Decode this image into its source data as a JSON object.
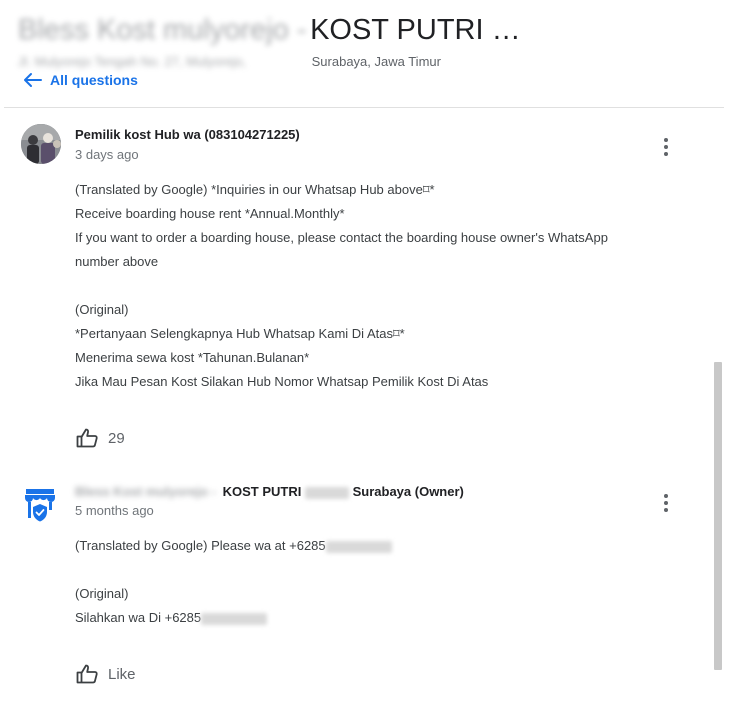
{
  "header": {
    "title_blurred": "Bless Kost mulyorejo -",
    "title": "KOST PUTRI …",
    "subtitle_blurred": "Jl. Mulyorejo Tengah No. 27, Mulyorejo,",
    "subtitle": "Surabaya, Jawa Timur"
  },
  "nav": {
    "back_label": "All questions"
  },
  "posts": [
    {
      "author": "Pemilik kost Hub wa (083104271225)",
      "time": "3 days ago",
      "lines": [
        "(Translated by Google) *Inquiries in our Whatsap Hub above⌑*",
        "Receive boarding house rent *Annual.Monthly*",
        "If you want to order a boarding house, please contact the boarding house owner's WhatsApp",
        "number above",
        "",
        "(Original)",
        "*Pertanyaan Selengkapnya Hub Whatsap Kami Di Atas⌑*",
        "Menerima sewa kost *Tahunan.Bulanan*",
        "Jika Mau Pesan Kost Silakan Hub Nomor Whatsap Pemilik Kost Di Atas"
      ],
      "likes": "29"
    },
    {
      "author_blurred": "Bless Kost mulyorejo -",
      "author_mid": "KOST PUTRI",
      "author_end": "Surabaya (Owner)",
      "time": "5 months ago",
      "line1": "(Translated by Google) Please wa at +6285",
      "line2": "(Original)",
      "line3": "Silahkan wa Di +6285",
      "like_label": "Like"
    }
  ],
  "icons": {
    "back": "arrow-left-icon",
    "more": "more-vert-icon",
    "thumb": "thumb-up-icon",
    "owner": "store-verified-icon"
  },
  "colors": {
    "link": "#1a73e8",
    "owner_icon": "#1a73e8",
    "text": "#202124",
    "muted": "#70757a"
  }
}
